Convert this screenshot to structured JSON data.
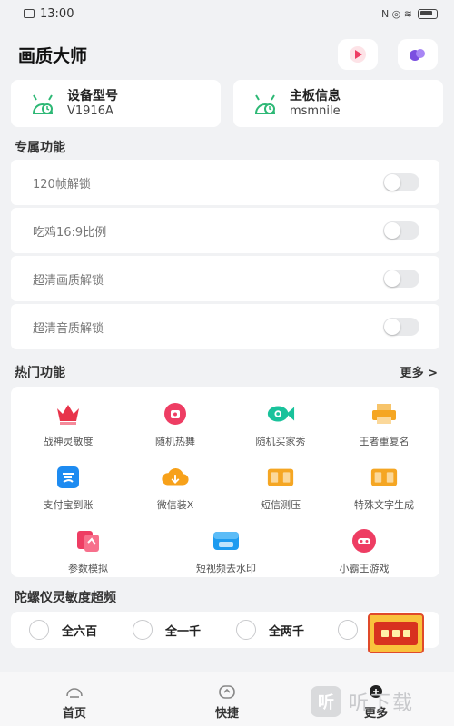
{
  "status_bar": {
    "time": "13:00",
    "indicators": "N ◎ ≋"
  },
  "app_bar": {
    "title": "画质大师"
  },
  "info_cards": [
    {
      "label": "设备型号",
      "value": "V1916A"
    },
    {
      "label": "主板信息",
      "value": "msmnile"
    }
  ],
  "sections": {
    "exclusive": "专属功能",
    "hot": "热门功能",
    "hot_more": "更多 >",
    "gyro": "陀螺仪灵敏度超频"
  },
  "toggles": [
    {
      "label": "120帧解锁",
      "on": false
    },
    {
      "label": "吃鸡16:9比例",
      "on": false
    },
    {
      "label": "超清画质解锁",
      "on": false
    },
    {
      "label": "超清音质解锁",
      "on": false
    }
  ],
  "hot_items": [
    {
      "label": "战神灵敏度",
      "icon": "crown-icon",
      "color": "#e8334a"
    },
    {
      "label": "随机热舞",
      "icon": "dance-icon",
      "color": "#ee3d63"
    },
    {
      "label": "随机买家秀",
      "icon": "fish-icon",
      "color": "#19c29b"
    },
    {
      "label": "王者重复名",
      "icon": "printer-icon",
      "color": "#f5a623"
    },
    {
      "label": "支付宝到账",
      "icon": "alipay-icon",
      "color": "#1d8bf1"
    },
    {
      "label": "微信装X",
      "icon": "cloud-icon",
      "color": "#f7a11a"
    },
    {
      "label": "短信测压",
      "icon": "message-icon",
      "color": "#f5a623"
    },
    {
      "label": "特殊文字生成",
      "icon": "text-icon",
      "color": "#f5a623"
    },
    {
      "label": "参数模拟",
      "icon": "params-icon",
      "color": "#ee3d63"
    },
    {
      "label": "短视频去水印",
      "icon": "video-icon",
      "color": "#1d9bf0"
    },
    {
      "label": "小霸王游戏",
      "icon": "gamepad-icon",
      "color": "#ee3d63"
    }
  ],
  "gyro_options": [
    "全六百",
    "全一千",
    "全两千"
  ],
  "bottom_nav": [
    {
      "label": "首页",
      "icon": "home-icon"
    },
    {
      "label": "快捷",
      "icon": "shortcut-icon"
    },
    {
      "label": "更多",
      "icon": "more-icon"
    }
  ],
  "watermark": {
    "logo": "听",
    "text": "听下载"
  },
  "colors": {
    "background": "#f1f2f4",
    "card": "#ffffff",
    "accent_red": "#ee3d63",
    "accent_purple": "#7b4fe0"
  }
}
